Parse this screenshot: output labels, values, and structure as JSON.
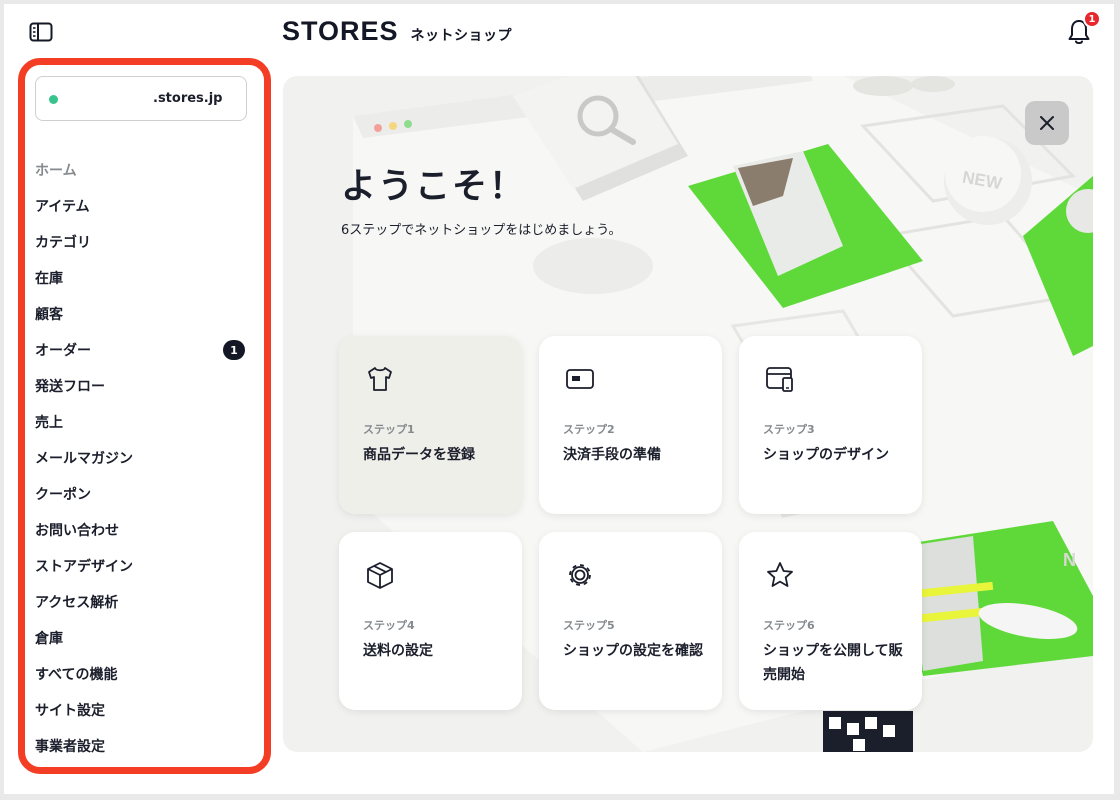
{
  "header": {
    "logo_main": "STORES",
    "logo_sub": "ネットショップ",
    "notification_count": "1"
  },
  "sidebar": {
    "store_domain": ".stores.jp",
    "items": [
      {
        "label": "ホーム",
        "active": true
      },
      {
        "label": "アイテム"
      },
      {
        "label": "カテゴリ"
      },
      {
        "label": "在庫"
      },
      {
        "label": "顧客"
      },
      {
        "label": "オーダー",
        "badge": "1"
      },
      {
        "label": "発送フロー"
      },
      {
        "label": "売上"
      },
      {
        "label": "メールマガジン"
      },
      {
        "label": "クーポン"
      },
      {
        "label": "お問い合わせ"
      },
      {
        "label": "ストアデザイン"
      },
      {
        "label": "アクセス解析"
      },
      {
        "label": "倉庫"
      },
      {
        "label": "すべての機能"
      },
      {
        "label": "サイト設定"
      },
      {
        "label": "事業者設定"
      }
    ]
  },
  "welcome": {
    "title": "ようこそ！",
    "subtitle": "6ステップでネットショップをはじめましょう。",
    "steps": [
      {
        "step": "ステップ1",
        "title": "商品データを登録",
        "icon": "tshirt-icon",
        "done": true
      },
      {
        "step": "ステップ2",
        "title": "決済手段の準備",
        "icon": "card-icon"
      },
      {
        "step": "ステップ3",
        "title": "ショップのデザイン",
        "icon": "store-window-icon"
      },
      {
        "step": "ステップ4",
        "title": "送料の設定",
        "icon": "box-icon"
      },
      {
        "step": "ステップ5",
        "title": "ショップの設定を確認",
        "icon": "gear-icon"
      },
      {
        "step": "ステップ6",
        "title": "ショップを公開して販売開始",
        "icon": "star-icon"
      }
    ]
  },
  "colors": {
    "accent_green": "#5fd93a",
    "highlight_red": "#f43d25",
    "badge_red": "#e8262e",
    "status_green": "#36c48c"
  }
}
